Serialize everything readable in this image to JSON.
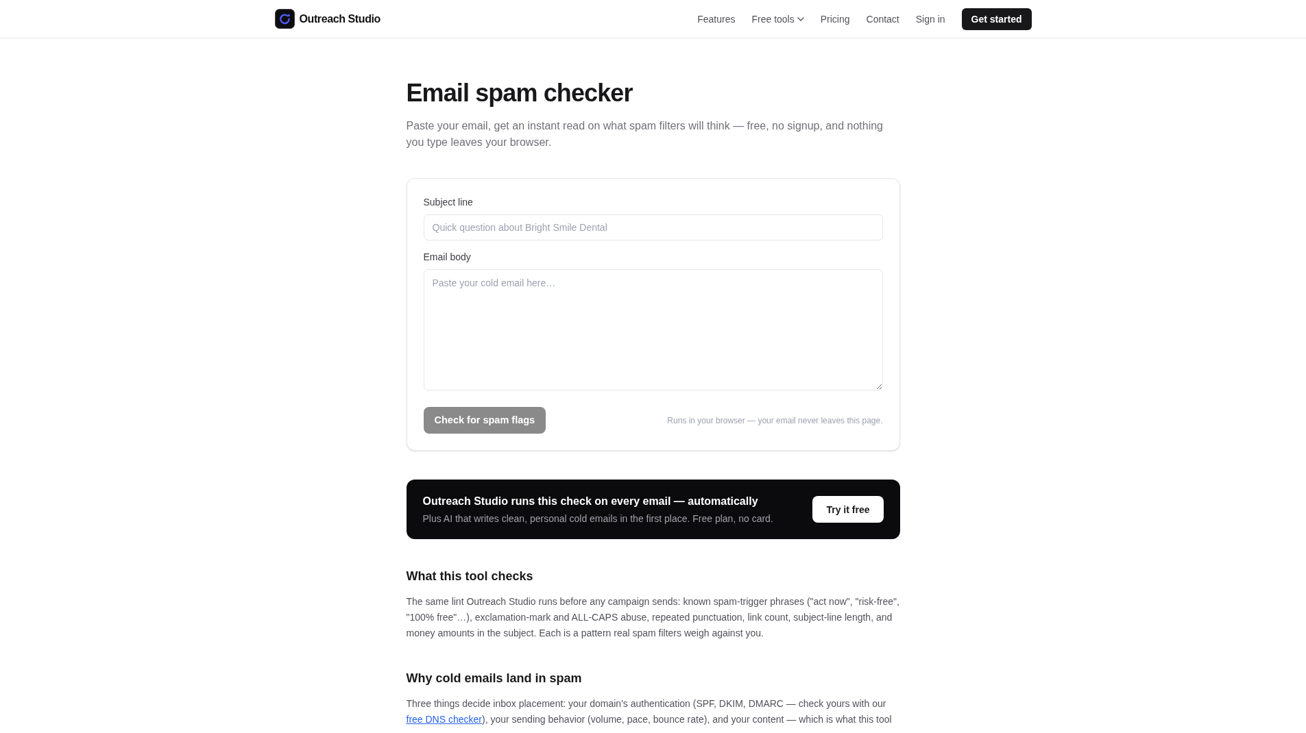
{
  "header": {
    "brand": "Outreach Studio",
    "nav": [
      {
        "label": "Features",
        "kind": "link"
      },
      {
        "label": "Free tools",
        "kind": "dropdown"
      },
      {
        "label": "Pricing",
        "kind": "link"
      },
      {
        "label": "Contact",
        "kind": "link"
      },
      {
        "label": "Sign in",
        "kind": "link"
      }
    ],
    "cta": "Get started"
  },
  "intro": {
    "title": "Email spam checker",
    "description": "Paste your email, get an instant read on what spam filters will think — free, no signup, and nothing you type leaves your browser."
  },
  "form": {
    "fields": [
      {
        "label": "Subject line",
        "kind": "input",
        "placeholder": "Quick question about Bright Smile Dental"
      },
      {
        "label": "Email body",
        "kind": "textarea",
        "placeholder": "Paste your cold email here…"
      }
    ],
    "submit": {
      "label": "Check for spam flags",
      "disabled": true
    },
    "note": "Runs in your browser — your email never leaves this page."
  },
  "promo": {
    "title": "Outreach Studio runs this check on every email — automatically",
    "text": "Plus AI that writes clean, personal cold emails in the first place. Free plan, no card.",
    "button": "Try it free"
  },
  "sections": [
    {
      "heading": "What this tool checks",
      "parts": [
        {
          "kind": "text",
          "text": "The same lint Outreach Studio runs before any campaign sends: known spam-trigger phrases (\"act now\", \"risk-free\", \"100% free\"…), exclamation-mark and ALL-CAPS abuse, repeated punctuation, link count, subject-line length, and money amounts in the subject. Each is a pattern real spam filters weigh against you."
        }
      ]
    },
    {
      "heading": "Why cold emails land in spam",
      "parts": [
        {
          "kind": "text",
          "text": "Three things decide inbox placement: your domain's authentication (SPF, DKIM, DMARC — check yours with our "
        },
        {
          "kind": "link",
          "text": "free DNS checker"
        },
        {
          "kind": "text",
          "text": "), your sending behavior (volume, pace, bounce rate), and your content — which is what this tool"
        }
      ]
    }
  ]
}
